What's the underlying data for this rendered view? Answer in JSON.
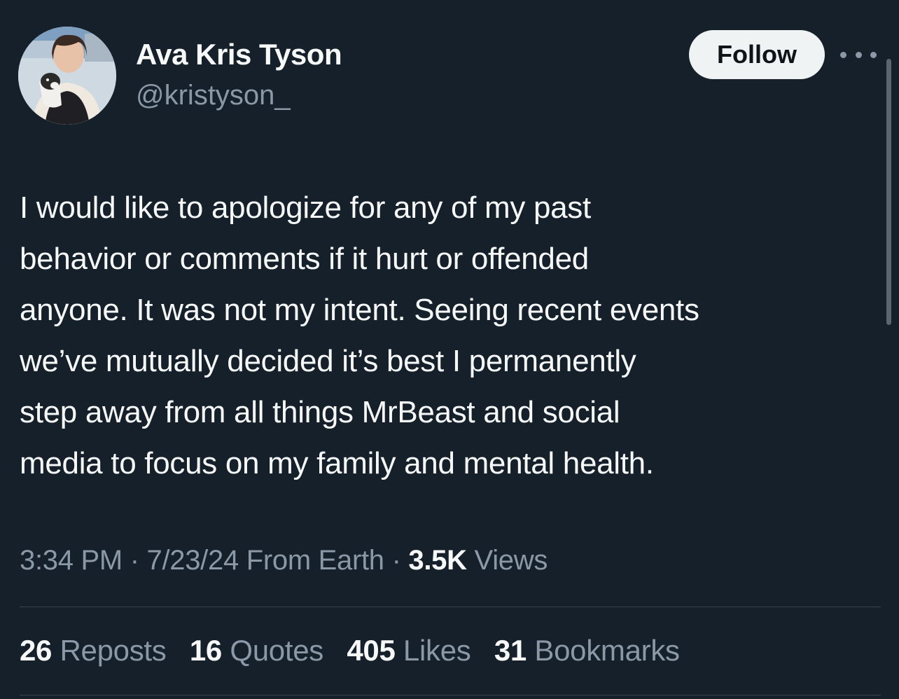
{
  "author": {
    "display_name": "Ava Kris Tyson",
    "handle": "@kristyson_",
    "avatar_icon": "profile-photo"
  },
  "header": {
    "follow_label": "Follow",
    "more_icon": "ellipsis-icon"
  },
  "tweet": {
    "lines": [
      "I would like to apologize for any of my past",
      "behavior or comments if it hurt or offended",
      "anyone. It was not my intent. Seeing recent events",
      "we’ve mutually decided it’s best I permanently",
      "step away from all things MrBeast and social",
      "media to focus on my family and mental health."
    ]
  },
  "meta": {
    "time": "3:34 PM",
    "separator": " · ",
    "date": "7/23/24",
    "source": "From Earth",
    "views_count": "3.5K",
    "views_label": "Views"
  },
  "stats": [
    {
      "count": "26",
      "label": "Reposts"
    },
    {
      "count": "16",
      "label": "Quotes"
    },
    {
      "count": "405",
      "label": "Likes"
    },
    {
      "count": "31",
      "label": "Bookmarks"
    }
  ],
  "colors": {
    "background": "#15202b",
    "primary_text": "#f7f9f9",
    "secondary_text": "#8b98a5",
    "divider": "#38444d",
    "follow_button_bg": "#eff3f4"
  }
}
